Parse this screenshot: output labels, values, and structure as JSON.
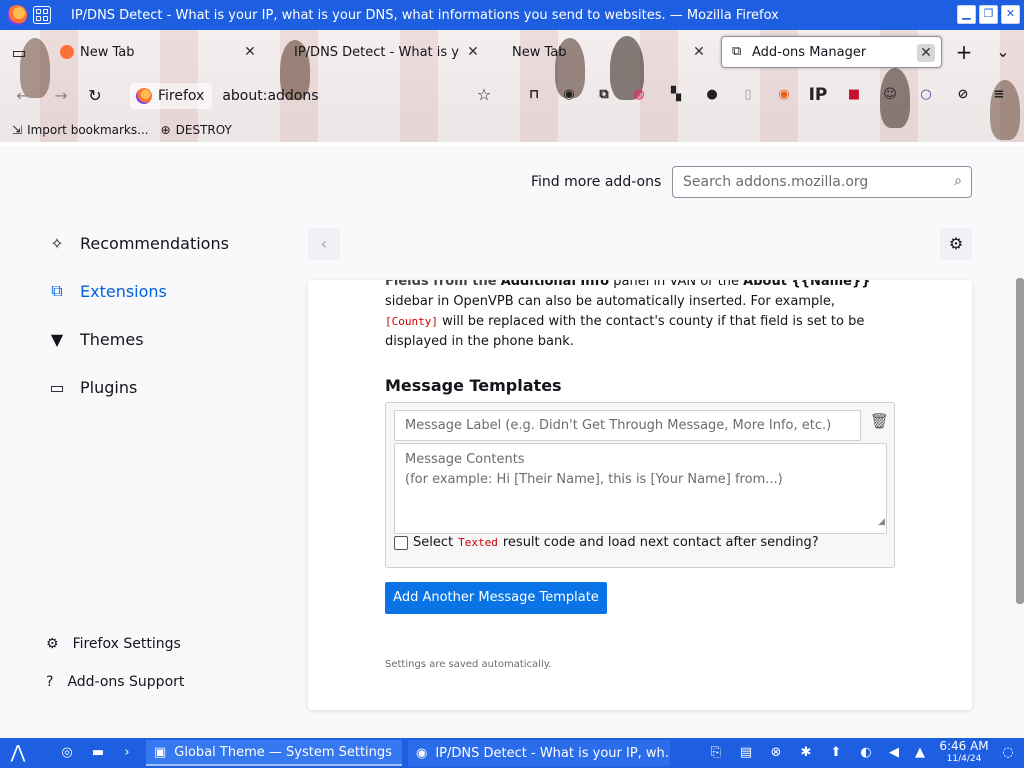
{
  "window": {
    "title": "IP/DNS Detect - What is your IP, what is your DNS, what informations you send to websites. — Mozilla Firefox"
  },
  "tabs": [
    {
      "label": "New Tab",
      "active": false
    },
    {
      "label": "IP/DNS Detect - What is yo",
      "active": false
    },
    {
      "label": "New Tab",
      "active": false
    },
    {
      "label": "Add-ons Manager",
      "active": true
    }
  ],
  "navbar": {
    "identity_label": "Firefox",
    "url": "about:addons",
    "ip_extension_label": "IP"
  },
  "bookmarks": [
    {
      "label": "Import bookmarks..."
    },
    {
      "label": "DESTROY"
    }
  ],
  "addons": {
    "find_more_label": "Find more add-ons",
    "search_placeholder": "Search addons.mozilla.org",
    "categories": [
      {
        "label": "Recommendations",
        "selected": false
      },
      {
        "label": "Extensions",
        "selected": true
      },
      {
        "label": "Themes",
        "selected": false
      },
      {
        "label": "Plugins",
        "selected": false
      }
    ],
    "footer": [
      {
        "label": "Firefox Settings"
      },
      {
        "label": "Add-ons Support"
      }
    ]
  },
  "options": {
    "intro_cut_start": "Fields from the",
    "intro_cut_bold1": "Additional Info",
    "intro_cut_mid": "panel in VAN or the",
    "intro_cut_bold2": "About {{Name}}",
    "intro_line2a": "sidebar in OpenVPB can also be automatically inserted. For example,",
    "intro_code": "[County]",
    "intro_line3": "will be replaced with the contact's county if that field is set to be displayed in the phone bank.",
    "message_templates_heading": "Message Templates",
    "label_placeholder": "Message Label (e.g. Didn't Get Through Message, More Info, etc.)",
    "contents_placeholder_line1": "Message Contents",
    "contents_placeholder_line2": "(for example: Hi [Their Name], this is [Your Name] from...)",
    "checkbox_before": "Select",
    "checkbox_code": "Texted",
    "checkbox_after": "result code and load next contact after sending?",
    "add_button": "Add Another Message Template",
    "saved_note": "Settings are saved automatically."
  },
  "taskbar": {
    "tasks": [
      {
        "label": "Global Theme — System Settings"
      },
      {
        "label": "IP/DNS Detect - What is your IP, wh..."
      }
    ],
    "time": "6:46 AM",
    "date": "11/4/24"
  },
  "colors": {
    "titlebar": "#1d5fe0",
    "accent": "#0061e0",
    "button": "#0a74e6"
  }
}
